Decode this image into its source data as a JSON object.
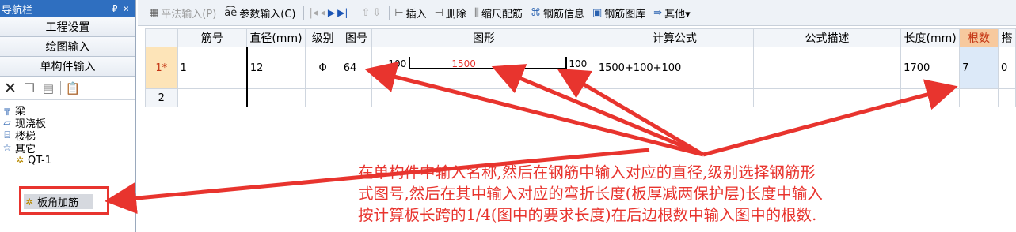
{
  "nav": {
    "title": "导航栏",
    "pin": "Ⴔ ×",
    "buttons": [
      "工程设置",
      "绘图输入",
      "单构件输入"
    ],
    "tree": [
      {
        "label": "梁",
        "icon": "beam-icon"
      },
      {
        "label": "现浇板",
        "icon": "slab-icon"
      },
      {
        "label": "楼梯",
        "icon": "stair-icon"
      },
      {
        "label": "其它",
        "icon": "star-icon"
      }
    ],
    "children": [
      {
        "label": "QT-1",
        "icon": "gear-icon"
      },
      {
        "label": "板角加筋",
        "icon": "gear-icon"
      }
    ]
  },
  "toolbar": {
    "items": [
      {
        "label": "平法输入(P)",
        "icon": "grid-icon",
        "disabled": true
      },
      {
        "label": "参数输入(C)",
        "icon": "param-icon",
        "disabled": false
      },
      {
        "label": "插入",
        "icon": "insert-icon",
        "disabled": false
      },
      {
        "label": "删除",
        "icon": "delete-icon",
        "disabled": false
      },
      {
        "label": "缩尺配筋",
        "icon": "scale-icon",
        "disabled": false
      },
      {
        "label": "钢筋信息",
        "icon": "info-icon",
        "disabled": false
      },
      {
        "label": "钢筋图库",
        "icon": "library-icon",
        "disabled": false
      },
      {
        "label": "其他▾",
        "icon": "other-icon",
        "disabled": false
      }
    ]
  },
  "grid": {
    "headers": [
      "",
      "筋号",
      "直径(mm)",
      "级别",
      "图号",
      "图形",
      "计算公式",
      "公式描述",
      "长度(mm)",
      "根数",
      "搭"
    ],
    "rows": [
      {
        "num": "1*",
        "jinhao": "1",
        "diameter": "12",
        "grade": "Φ",
        "tuhao": "64",
        "shape_left": "100",
        "shape_mid": "1500",
        "shape_right": "100",
        "formula": "1500+100+100",
        "desc": "",
        "length": "1700",
        "count": "7",
        "lap": "0"
      },
      {
        "num": "2",
        "jinhao": "",
        "diameter": "",
        "grade": "",
        "tuhao": "",
        "shape_left": "",
        "shape_mid": "",
        "shape_right": "",
        "formula": "",
        "desc": "",
        "length": "",
        "count": "",
        "lap": ""
      }
    ]
  },
  "annotation": {
    "lines": [
      "在单构件中输入名称,然后在钢筋中输入对应的直径,级别选择钢筋形",
      "式图号,然后在其中输入对应的弯折长度(板厚减两保护层)长度中输入",
      "按计算板长跨的1/4(图中的要求长度)在后边根数中输入图中的根数."
    ]
  },
  "colors": {
    "accent_red": "#e8342e",
    "nav_header": "#2f6fc0",
    "count_header": "#f7c99e"
  }
}
